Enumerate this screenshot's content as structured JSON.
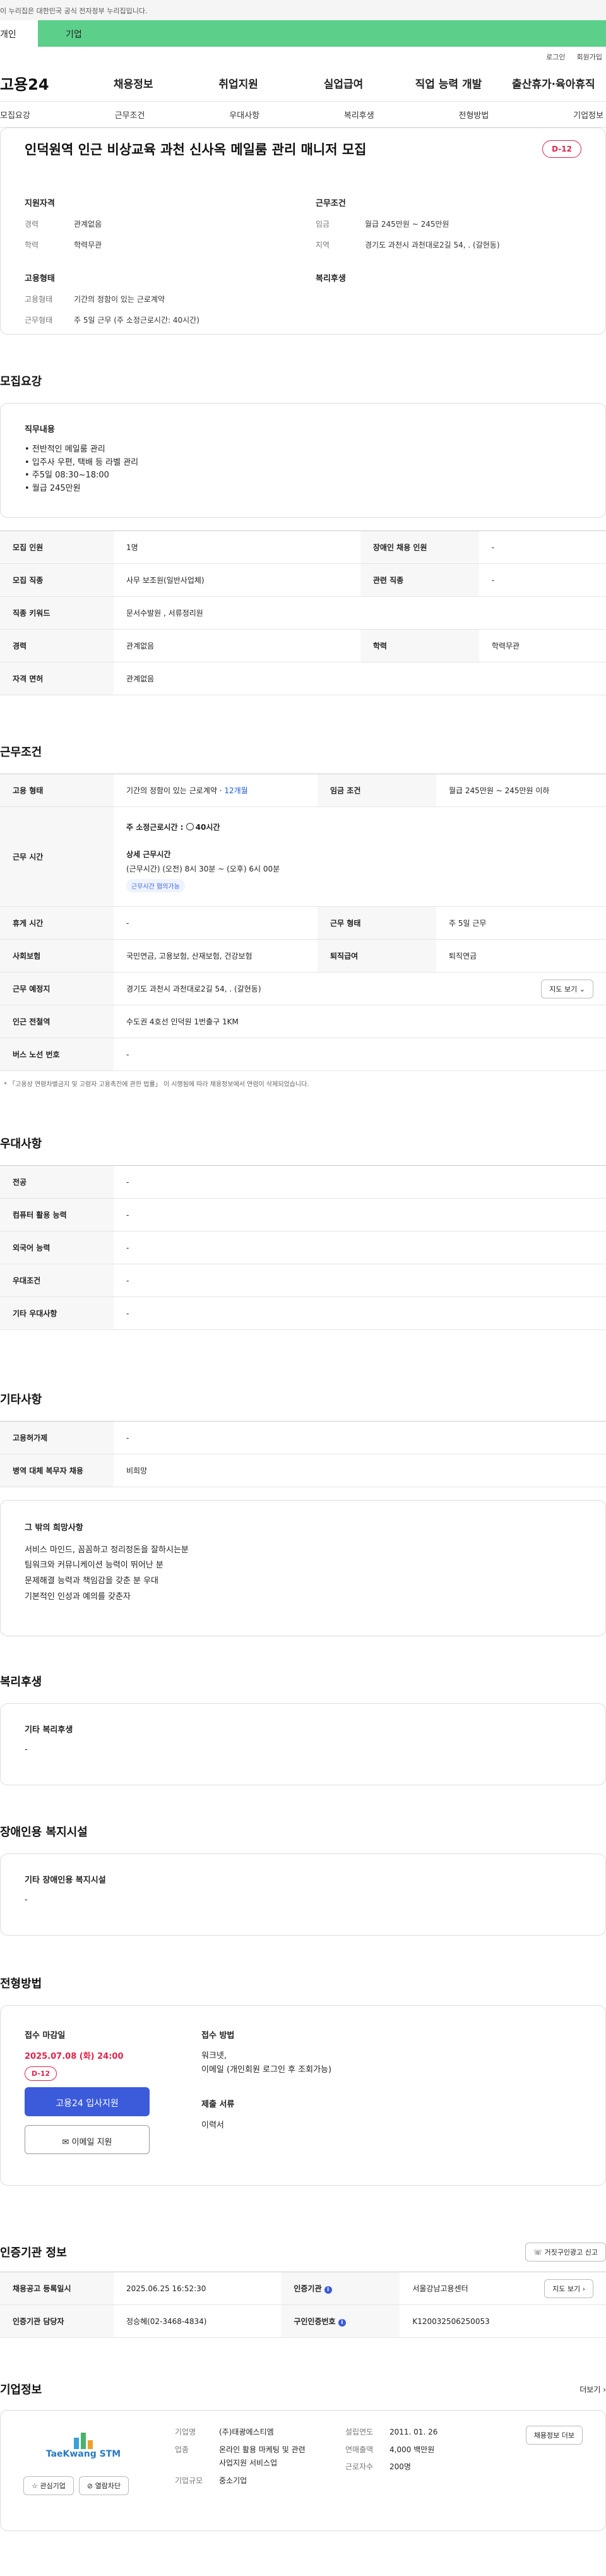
{
  "gov_banner": "이 누리집은 대한민국 공식 전자정부 누리집입니다.",
  "tabs": {
    "personal": "개인",
    "company": "기업"
  },
  "utils": {
    "login": "로그인",
    "signup": "회원가입"
  },
  "logo": "고용24",
  "gnb": [
    "채용정보",
    "취업지원",
    "실업급여",
    "직업 능력 개발",
    "출산휴가·육아휴직"
  ],
  "subnav": [
    "모집요강",
    "근무조건",
    "우대사항",
    "복리후생",
    "전형방법",
    "기업정보"
  ],
  "summary": {
    "title": "인덕원역 인근 비상교육 과천 신사옥 메일룸 관리 매니저 모집",
    "dday": "D-12",
    "qual_title": "지원자격",
    "career_k": "경력",
    "career_v": "관계없음",
    "edu_k": "학력",
    "edu_v": "학력무관",
    "cond_title": "근무조건",
    "wage_k": "임금",
    "wage_v": "월급 245만원 ~ 245만원",
    "region_k": "지역",
    "region_v": "경기도 과천시 과천대로2길 54, . (갈현동)",
    "emp_title": "고용형태",
    "emptype_k": "고용형태",
    "emptype_v": "기간의 정함이 있는 근로계약",
    "worktype_k": "근무형태",
    "worktype_v": "주 5일 근무 (주 소정근로시간: 40시간)",
    "welfare_title": "복리후생"
  },
  "recruit": {
    "title": "모집요강",
    "duty_title": "직무내용",
    "duties": [
      "• 전반적인 메일룸 관리",
      "• 입주사 우편, 택배 등 라벨 관리",
      "• 주5일 08:30~18:00",
      "• 월급 245만원"
    ],
    "rows": [
      [
        "모집 인원",
        "1명",
        "장애인 채용 인원",
        "-"
      ],
      [
        "모집 직종",
        "사무 보조원(일반사업체)",
        "관련 직종",
        "-"
      ],
      [
        "직종 키워드",
        "문서수발원 , 서류정리원",
        "",
        ""
      ],
      [
        "경력",
        "관계없음",
        "학력",
        "학력무관"
      ],
      [
        "자격 면허",
        "관계없음",
        "",
        ""
      ]
    ]
  },
  "work": {
    "title": "근무조건",
    "emp_k": "고용 형태",
    "emp_v": "기간의 정함이 있는 근로계약 · ",
    "emp_months": "12개월",
    "wage_k": "임금 조건",
    "wage_v": "월급 245만원 ~ 245만원 이하",
    "hours_k": "근무 시간",
    "hours_main": "주 소정근로시간 : ",
    "hours_icon_label": "40시간",
    "hours_detail_title": "상세 근무시간",
    "hours_detail": "(근무시간) (오전) 8시 30분 ~ (오후) 6시 00분",
    "hours_chip": "근무시간 협의가능",
    "break_k": "휴게 시간",
    "break_v": "-",
    "form_k": "근무 형태",
    "form_v": "주 5일 근무",
    "ins_k": "사회보험",
    "ins_v": "국민연금, 고용보험, 산재보험, 건강보험",
    "ret_k": "퇴직급여",
    "ret_v": "퇴직연금",
    "place_k": "근무 예정지",
    "place_v": "경기도 과천시 과천대로2길 54, . (갈현동)",
    "map_btn": "지도 보기",
    "station_k": "인근 전철역",
    "station_v": "수도권 4호선 인덕원 1번출구 1KM",
    "bus_k": "버스 노선 번호",
    "bus_v": "-",
    "note": "* 「고용상 연령차별금지 및 고령자 고용촉진에 관한 법률」 이 시행됨에 따라 채용정보에서 연령이 삭제되었습니다."
  },
  "pref": {
    "title": "우대사항",
    "rows": [
      [
        "전공",
        "-"
      ],
      [
        "컴퓨터 활용 능력",
        "-"
      ],
      [
        "외국어 능력",
        "-"
      ],
      [
        "우대조건",
        "-"
      ],
      [
        "기타 우대사항",
        "-"
      ]
    ]
  },
  "etc": {
    "title": "기타사항",
    "rows": [
      [
        "고용허가제",
        "-"
      ],
      [
        "병역 대체 복무자 채용",
        "비희망"
      ]
    ],
    "wish_title": "그 밖의 희망사항",
    "wishes": [
      "서비스 마인드, 꼼꼼하고 정리정돈을 잘하시는분",
      "팀워크와 커뮤니케이션 능력이 뛰어난 분",
      "문제해결 능력과 책임감을 갖춘 분 우대",
      "기본적인 인성과 예의를 갖춘자"
    ]
  },
  "welfare": {
    "title": "복리후생",
    "box_title": "기타 복리후생",
    "box_v": "-"
  },
  "disabled": {
    "title": "장애인용 복지시설",
    "box_title": "기타 장애인용 복지시설",
    "box_v": "-"
  },
  "process": {
    "title": "전형방법",
    "deadline_title": "접수 마감일",
    "deadline_v": "2025.07.08 (화) 24:00",
    "dday": "D-12",
    "apply_btn": "고용24 입사지원",
    "email_btn": "이메일 지원",
    "method_title": "접수 방법",
    "method_v1": "워크넷,",
    "method_v2": "이메일 (개인회원 로그인 후 조회가능)",
    "docs_title": "제출 서류",
    "docs_v": "이력서"
  },
  "cert": {
    "title": "인증기관 정보",
    "report_btn": "거짓구인광고 신고",
    "reg_k": "채용공고 등록일시",
    "reg_v": "2025.06.25 16:52:30",
    "org_k": "인증기관",
    "org_v": "서울강남고용센터",
    "map_btn": "지도 보기",
    "mgr_k": "인증기관 담당자",
    "mgr_v": "정승혜(02-3468-4834)",
    "no_k": "구인인증번호",
    "no_v": "K120032506250053"
  },
  "company": {
    "title": "기업정보",
    "more": "더보기",
    "logo_text": "TaeKwang STM",
    "fav_btn": "관심기업",
    "block_btn": "열람차단",
    "name_k": "기업명",
    "name_v": "(주)태광에스티엠",
    "biz_k": "업종",
    "biz_v": "온라인 활용 마케팅 및 관련 사업지원 서비스업",
    "size_k": "기업규모",
    "size_v": "중소기업",
    "est_k": "설립연도",
    "est_v": "2011. 01. 26",
    "sales_k": "연매출액",
    "sales_v": "4,000 백만원",
    "emp_k": "근로자수",
    "emp_v": "200명",
    "job_btn": "채용정보 더보"
  }
}
